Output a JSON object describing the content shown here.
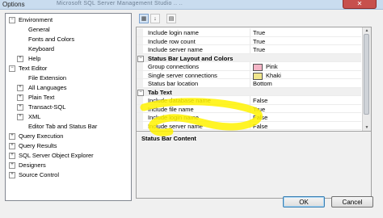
{
  "window": {
    "title": "Options",
    "background_text": "Microsoft SQL Server Management Studio  ..  ..",
    "close_label": "✕"
  },
  "tree": {
    "items": [
      {
        "label": "Environment",
        "expander": "−"
      },
      {
        "label": "General"
      },
      {
        "label": "Fonts and Colors"
      },
      {
        "label": "Keyboard"
      },
      {
        "label": "Help",
        "expander": "+"
      },
      {
        "label": "Text Editor",
        "expander": "−"
      },
      {
        "label": "File Extension"
      },
      {
        "label": "All Languages",
        "expander": "+"
      },
      {
        "label": "Plain Text",
        "expander": "+"
      },
      {
        "label": "Transact-SQL",
        "expander": "+"
      },
      {
        "label": "XML",
        "expander": "+"
      },
      {
        "label": "Editor Tab and Status Bar"
      },
      {
        "label": "Query Execution",
        "expander": "+"
      },
      {
        "label": "Query Results",
        "expander": "+"
      },
      {
        "label": "SQL Server Object Explorer",
        "expander": "+"
      },
      {
        "label": "Designers",
        "expander": "+"
      },
      {
        "label": "Source Control",
        "expander": "+"
      }
    ]
  },
  "toolbar": {
    "categorized_icon": "categorized-icon",
    "alphabetical_icon": "alphabetical-icon",
    "property_pages_icon": "property-pages-icon"
  },
  "grid": {
    "rows": [
      {
        "type": "prop",
        "name": "Include login name",
        "value": "True"
      },
      {
        "type": "prop",
        "name": "Include row count",
        "value": "True"
      },
      {
        "type": "prop",
        "name": "Include server name",
        "value": "True"
      },
      {
        "type": "cat",
        "name": "Status Bar Layout and Colors",
        "toggle": "−"
      },
      {
        "type": "color",
        "name": "Group connections",
        "value": "Pink",
        "color": "#f4b5c6"
      },
      {
        "type": "color",
        "name": "Single server connections",
        "value": "Khaki",
        "color": "#f0e68c"
      },
      {
        "type": "prop",
        "name": "Status bar location",
        "value": "Bottom"
      },
      {
        "type": "cat",
        "name": "Tab Text",
        "toggle": "−"
      },
      {
        "type": "prop",
        "name": "Include database name",
        "value": "False"
      },
      {
        "type": "prop",
        "name": "Include file name",
        "value": "True"
      },
      {
        "type": "prop",
        "name": "Include login name",
        "value": "False"
      },
      {
        "type": "prop",
        "name": "Include server name",
        "value": "False"
      }
    ]
  },
  "description": {
    "title": "Status Bar Content"
  },
  "buttons": {
    "ok": "OK",
    "cancel": "Cancel"
  },
  "colors": {
    "highlighter": "#fff200"
  }
}
